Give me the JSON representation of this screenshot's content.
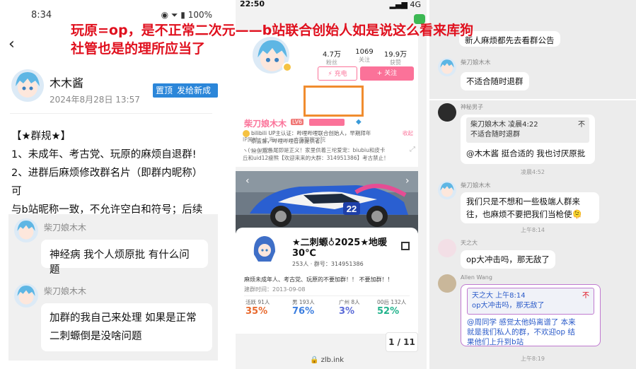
{
  "overlay": {
    "line1": "玩原=op，是不正常二次元——b站联合创始人如是说这么看来库狗",
    "line2": "社管也是的理所应当了"
  },
  "left_panel": {
    "status_time": "8:34",
    "status_right": "100%",
    "post": {
      "author": "木木酱",
      "date": "2024年8月28日 13:57",
      "pin_label": "置顶",
      "new_member_label": "发给新成员"
    },
    "rules": {
      "title": "【★群规★】",
      "line1": "1、未成年、考古党、玩原的麻烦自退群!",
      "line2": "2、进群后麻烦修改群名片（即群内昵称）可",
      "line3": "与b站昵称一致，不允许空白和符号；后续如"
    },
    "messages": [
      {
        "sender": "柴刀娘木木",
        "text": "神经病 我个人烦原批 有什么问题"
      },
      {
        "sender": "柴刀娘木木",
        "line1": "加群的我自己来处理 如果是正常",
        "line2": "二刺螈倒是没啥问题"
      }
    ]
  },
  "middle_panel": {
    "status_time": "22:50",
    "status_signal": "4G",
    "stats": [
      {
        "value": "4.7万",
        "label": "粉丝"
      },
      {
        "value": "1069",
        "label": "关注"
      },
      {
        "value": "19.9万",
        "label": "获赞"
      }
    ],
    "charge_label": "⚡ 充电",
    "follow_label": "+ 关注",
    "username": "柴刀娘木木",
    "level": "LV6",
    "verify_line1": "bilibili UP主认证：哔哩哔哩联合创始人，早期拜年",
    "verify_line2": "祭监督，哔哩哔哩音源提供者。",
    "collapse": "收起",
    "bio_line1": "ヽ(·ω·)ﾉ双马尾即是正义！家里供着三坨爱宠：biubiu和皮卡",
    "bio_line2": "丘和uid12瘦熊【欢迎来来的大群：314951386】考古禁止！",
    "ip_label": "IP属地：上海",
    "school": "广西警察学院",
    "fans_medal": "粉丝勋章",
    "car_number": "22",
    "group": {
      "name_line1": "★二刺螈♁2025★地暖",
      "name_line2": "30℃",
      "members": "253人 · 群号：314951386",
      "desc": "麻烦未成年人、考古党、玩原的不要加群！！ 不要加群！！",
      "created": "建群时间：2013-09-08",
      "stats": [
        {
          "label": "活跃 91人",
          "value": "35%",
          "color": "#e8692d"
        },
        {
          "label": "男 193人",
          "value": "76%",
          "color": "#3d7fe0"
        },
        {
          "label": "广州 8人",
          "value": "3%",
          "color": "#5b6bd8"
        },
        {
          "label": "00后 132人",
          "value": "52%",
          "color": "#22b38c"
        }
      ]
    },
    "pager": "1 / 11",
    "url": "zlb.ink"
  },
  "right_panel": {
    "top_bubble_line1": "新人麻烦都先去看群公告",
    "msg1": {
      "sender": "柴刀娘木木",
      "text": "不适合随时退群"
    },
    "msg2": {
      "sender": "神秘男子",
      "quote_line1": "柴刀娘木木 凌晨4:22",
      "quote_line2": "不适合随时退群",
      "quote_mark": "不",
      "text": "@木木酱 挺合适的 我也讨厌原批"
    },
    "ts1": "凌晨4:52",
    "msg3": {
      "sender": "柴刀娘木木",
      "line1": "我们只是不想和一些极端人群来",
      "line2": "往，也麻烦不要把我们当枪使🫠"
    },
    "ts2": "上午8:14",
    "msg4": {
      "sender": "天之大",
      "text": "op大冲击吗，那无敌了"
    },
    "msg5": {
      "sender": "Allen Wang",
      "quote_line1": "天之大 上午8:14",
      "quote_line2": "op大冲击吗，那无敌了",
      "quote_mark": "不",
      "line1": "@周同学 感觉太他妈离谱了 本来",
      "line2": "就是我们私人的群，不欢迎op 结",
      "line3": "果他们上升到b站"
    },
    "ts3": "上午8:19",
    "colors": {
      "reply_border": "#c07ad0",
      "mention": "#2b5bc9"
    }
  }
}
